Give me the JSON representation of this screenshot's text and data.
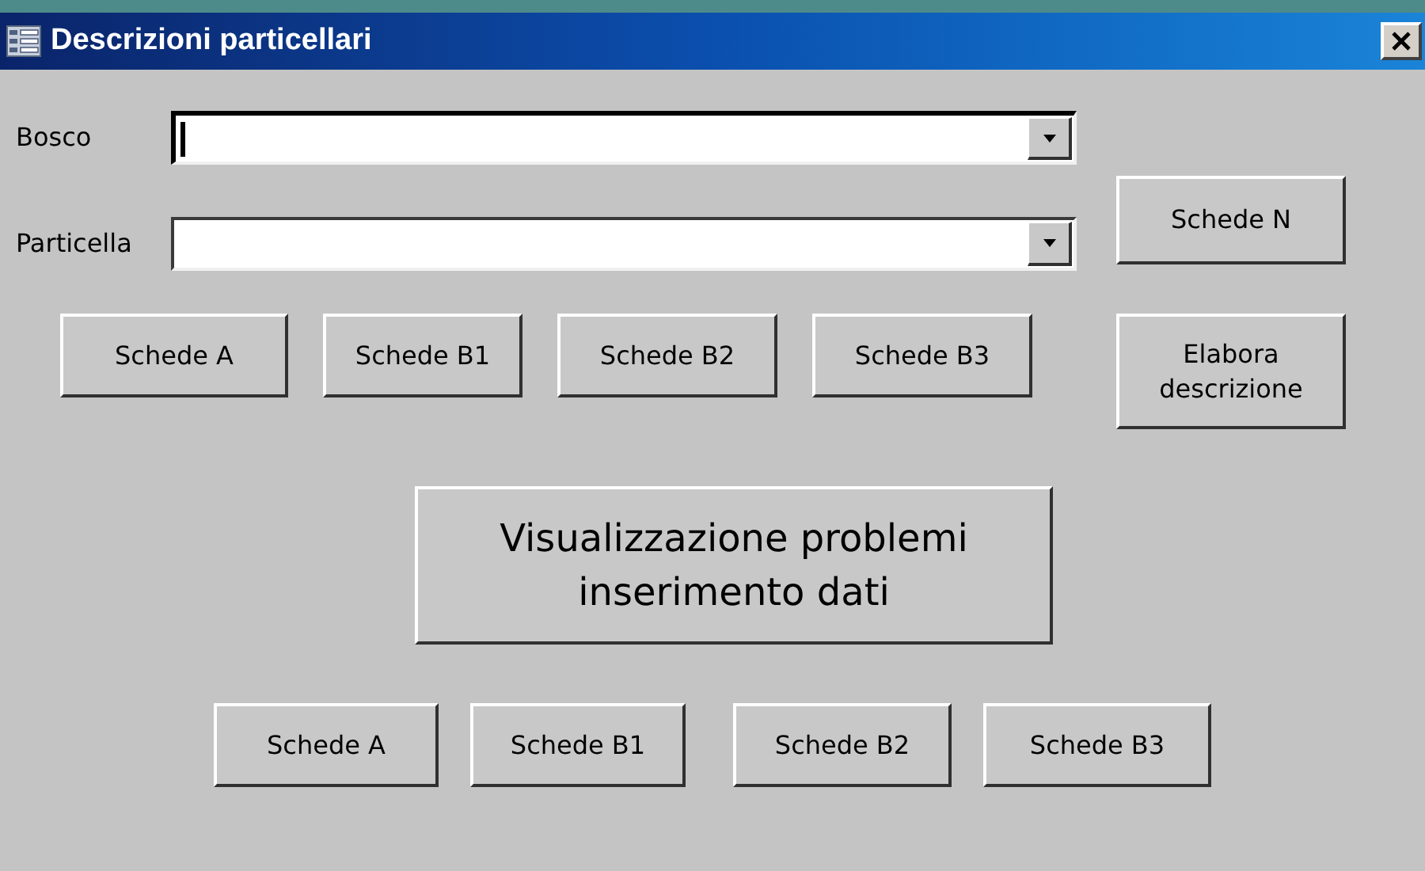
{
  "window": {
    "title": "Descrizioni particellari"
  },
  "fields": [
    {
      "label": "Bosco",
      "focused": true
    },
    {
      "label": "Particella",
      "focused": false
    }
  ],
  "side_button": "Schede N",
  "buttons_row_1": [
    "Schede A",
    "Schede B1",
    "Schede B2",
    "Schede B3"
  ],
  "process_button": "Elabora descrizione",
  "problems_button": "Visualizzazione problemi inserimento dati",
  "buttons_row_2": [
    "Schede A",
    "Schede B1",
    "Schede B2",
    "Schede B3"
  ]
}
